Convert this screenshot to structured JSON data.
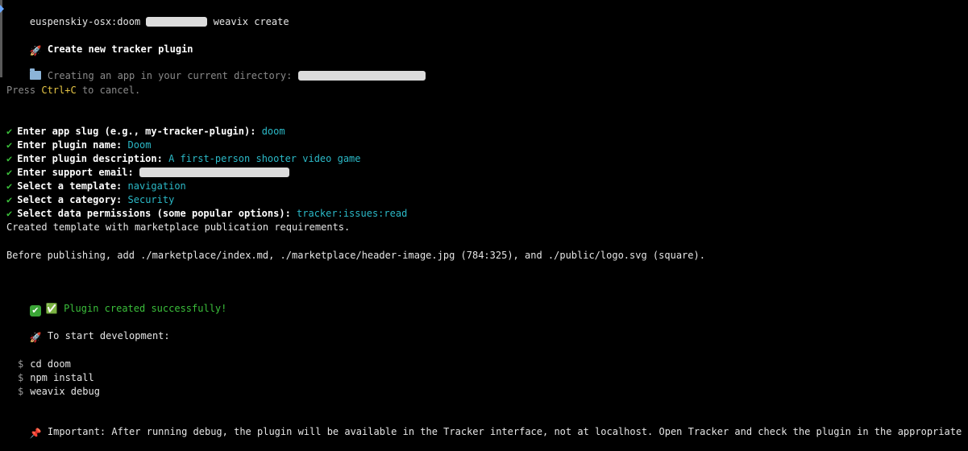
{
  "prompt": {
    "host_path": "euspenskiy-osx:doom",
    "command": "weavix create"
  },
  "header": {
    "title": "Create new tracker plugin",
    "creating_text": "Creating an app in your current directory:",
    "press_prefix": "Press ",
    "press_key": "Ctrl+C",
    "press_suffix": " to cancel."
  },
  "answers": [
    {
      "question": "Enter app slug (e.g., my-tracker-plugin):",
      "answer": "doom"
    },
    {
      "question": "Enter plugin name:",
      "answer": "Doom"
    },
    {
      "question": "Enter plugin description:",
      "answer": "A first-person shooter video game"
    },
    {
      "question": "Enter support email:",
      "answer": ""
    },
    {
      "question": "Select a template:",
      "answer": "navigation"
    },
    {
      "question": "Select a category:",
      "answer": "Security"
    },
    {
      "question": "Select data permissions (some popular options):",
      "answer": "tracker:issues:read"
    }
  ],
  "check_glyph": "✔",
  "created_template": "Created template with marketplace publication requirements.",
  "before_publishing": "Before publishing, add ./marketplace/index.md, ./marketplace/header-image.jpg (784:325), and ./public/logo.svg (square).",
  "success": "✅ Plugin created successfully!",
  "start_dev": "To start development:",
  "commands": [
    "cd doom",
    "npm install",
    "weavix debug"
  ],
  "dollar": "$",
  "important": "Important: After running debug, the plugin will be available in the Tracker interface, not at localhost. Open Tracker and check the plugin in the appropriate context.",
  "icons": {
    "rocket": "🚀",
    "pin": "📌",
    "check_box": "✔"
  },
  "colors": {
    "background": "#000000",
    "cyan": "#2bb9c7",
    "yellow": "#e5c545",
    "green": "#3bbf3b"
  }
}
